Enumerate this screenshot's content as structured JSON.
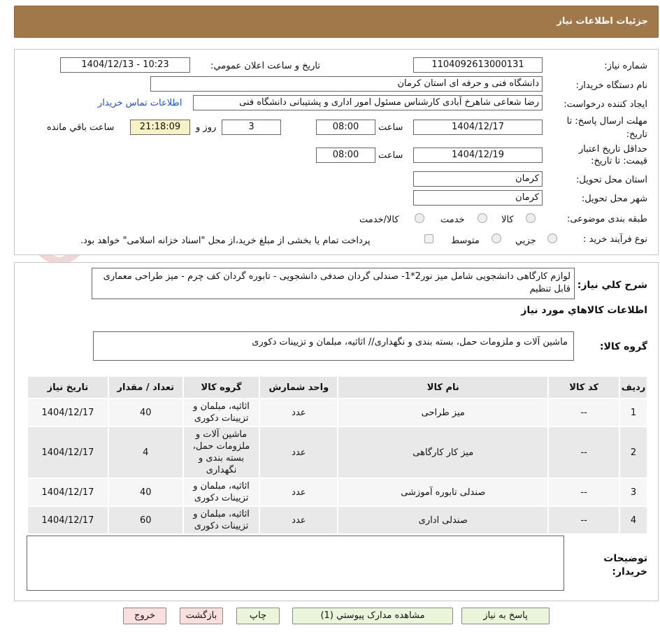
{
  "header": {
    "title": "جزئیات اطلاعات نیاز"
  },
  "watermark": {
    "text": "AriaTender.neT"
  },
  "form": {
    "need_number_label": "شماره نیاز:",
    "need_number": "1104092613000131",
    "announce_label": "تاریخ و ساعت اعلان عمومي:",
    "announce_value": "1404/12/13 - 10:23",
    "buyer_org_label": "نام دستگاه خریدار:",
    "buyer_org": "دانشگاه فنی و حرفه ای استان کرمان",
    "creator_label": "ایجاد کننده درخواست:",
    "creator": "رضا شعاعی شاهرخ آبادی کارشناس مسئول امور اداری و پشتیبانی دانشگاه فنی",
    "contact_link": "اطلاعات تماس خریدار",
    "deadline_label": "مهلت ارسال پاسخ: تا تاریخ:",
    "deadline_date": "1404/12/17",
    "time_label": "ساعت",
    "deadline_time": "08:00",
    "days_value": "3",
    "days_label": "روز و",
    "remaining_time": "21:18:09",
    "remaining_label": "ساعت باقي مانده",
    "validity_label": "حداقل تاریخ اعتبار قیمت: تا تاریخ:",
    "validity_date": "1404/12/19",
    "validity_time": "08:00",
    "province_label": "استان محل تحویل:",
    "province": "کرمان",
    "city_label": "شهر محل تحویل:",
    "city": "کرمان",
    "category_label": "طبقه بندی موضوعی:",
    "category_options": [
      "کالا",
      "خدمت",
      "کالا/خدمت"
    ],
    "purchase_type_label": "نوع فرآیند خرید :",
    "purchase_type_options": [
      "جزیي",
      "متوسط"
    ],
    "payment_note": "پرداخت تمام یا بخشی از مبلغ خرید،از محل \"اسناد خزانه اسلامی\" خواهد بود."
  },
  "description": {
    "label": "شرح کلي نياز:",
    "text": "لوازم کارگاهی دانشجویی شامل میز نور2*1- صندلی گردان صدفی دانشجویی - تابوره گردان کف چرم - میز طراحی معماری قابل تنظیم"
  },
  "goods": {
    "section_title": "اطلاعات کالاهاي مورد نياز",
    "group_label": "گروه کالا:",
    "group_text": "ماشین آلات و ملزومات حمل، بسته بندی و نگهداری// اثاثیه، مبلمان و تزیینات دکوری",
    "columns": [
      "رديف",
      "کد کالا",
      "نام کالا",
      "واحد شمارش",
      "گروه کالا",
      "تعداد / مقدار",
      "تاریخ نیاز"
    ],
    "rows": [
      {
        "idx": "1",
        "code": "--",
        "name": "میز طراحی",
        "unit": "عدد",
        "group": "اثاثیه، مبلمان و تزیینات دکوری",
        "qty": "40",
        "date": "1404/12/17"
      },
      {
        "idx": "2",
        "code": "--",
        "name": "میز کار کارگاهی",
        "unit": "عدد",
        "group": "ماشین آلات و ملزومات حمل، بسته بندی و نگهداری",
        "qty": "4",
        "date": "1404/12/17"
      },
      {
        "idx": "3",
        "code": "--",
        "name": "صندلی تابوره آموزشی",
        "unit": "عدد",
        "group": "اثاثیه، مبلمان و تزیینات دکوری",
        "qty": "40",
        "date": "1404/12/17"
      },
      {
        "idx": "4",
        "code": "--",
        "name": "صندلی اداری",
        "unit": "عدد",
        "group": "اثاثیه، مبلمان و تزیینات دکوری",
        "qty": "60",
        "date": "1404/12/17"
      }
    ]
  },
  "buyer_notes": {
    "label": "توضیحات خریدار:",
    "text": ""
  },
  "buttons": {
    "reply": "پاسخ به نیاز",
    "attachments": "مشاهده مدارک پیوستي (1)",
    "print": "چاپ",
    "back": "بازگشت",
    "exit": "خروج"
  }
}
